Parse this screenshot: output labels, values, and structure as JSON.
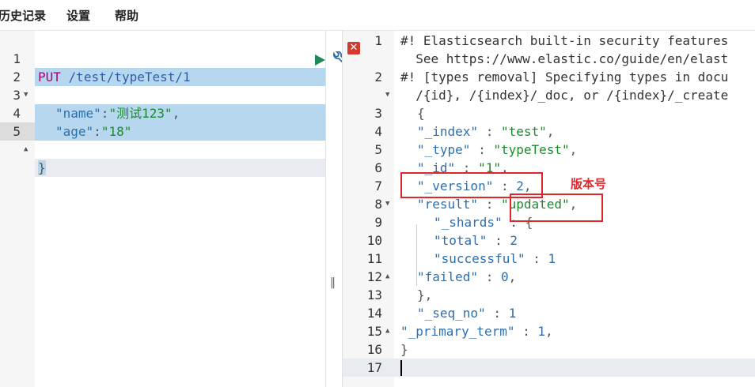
{
  "menu": {
    "history": "历史记录",
    "settings": "设置",
    "help": "帮助"
  },
  "request": {
    "lines": [
      {
        "n": "1",
        "method": "PUT",
        "path": "/test/typeTest/1"
      },
      {
        "n": "2",
        "text": "{"
      },
      {
        "n": "3",
        "key": "\"name\"",
        "value": "\"测试123\""
      },
      {
        "n": "4",
        "key": "\"age\"",
        "value": "\"18\""
      },
      {
        "n": "5",
        "text": "}"
      }
    ]
  },
  "response": {
    "lines": [
      {
        "n": "1",
        "text": "#! Elasticsearch built-in security features"
      },
      {
        "n": "",
        "text": "  See https://www.elastic.co/guide/en/elast"
      },
      {
        "n": "2",
        "text": "#! [types removal] Specifying types in docu"
      },
      {
        "n": "",
        "text": "  /{id}, /{index}/_doc, or /{index}/_create"
      },
      {
        "n": "3",
        "text": "{"
      },
      {
        "n": "4",
        "key": "\"_index\"",
        "value": "\"test\"",
        "vtype": "str"
      },
      {
        "n": "5",
        "key": "\"_type\"",
        "value": "\"typeTest\"",
        "vtype": "str"
      },
      {
        "n": "6",
        "key": "\"_id\"",
        "value": "\"1\"",
        "vtype": "str"
      },
      {
        "n": "7",
        "key": "\"_version\"",
        "value": "2",
        "vtype": "num"
      },
      {
        "n": "8",
        "key": "\"result\"",
        "value": "\"updated\"",
        "vtype": "str"
      },
      {
        "n": "9",
        "key": "\"_shards\"",
        "value": "{",
        "vtype": "punc"
      },
      {
        "n": "10",
        "key": "\"total\"",
        "value": "2",
        "vtype": "num"
      },
      {
        "n": "11",
        "key": "\"successful\"",
        "value": "1",
        "vtype": "num"
      },
      {
        "n": "12",
        "key": "\"failed\"",
        "value": "0",
        "vtype": "num"
      },
      {
        "n": "13",
        "text": "},"
      },
      {
        "n": "14",
        "key": "\"_seq_no\"",
        "value": "1",
        "vtype": "num"
      },
      {
        "n": "15",
        "key": "\"_primary_term\"",
        "value": "1",
        "vtype": "num"
      },
      {
        "n": "16",
        "text": "}"
      },
      {
        "n": "17",
        "text": ""
      }
    ]
  },
  "annotation": {
    "label": "版本号",
    "color": "#e0262b"
  },
  "colors": {
    "selection": "#b6d7ee",
    "run": "#1e8a5a",
    "error": "#d23a2f"
  }
}
